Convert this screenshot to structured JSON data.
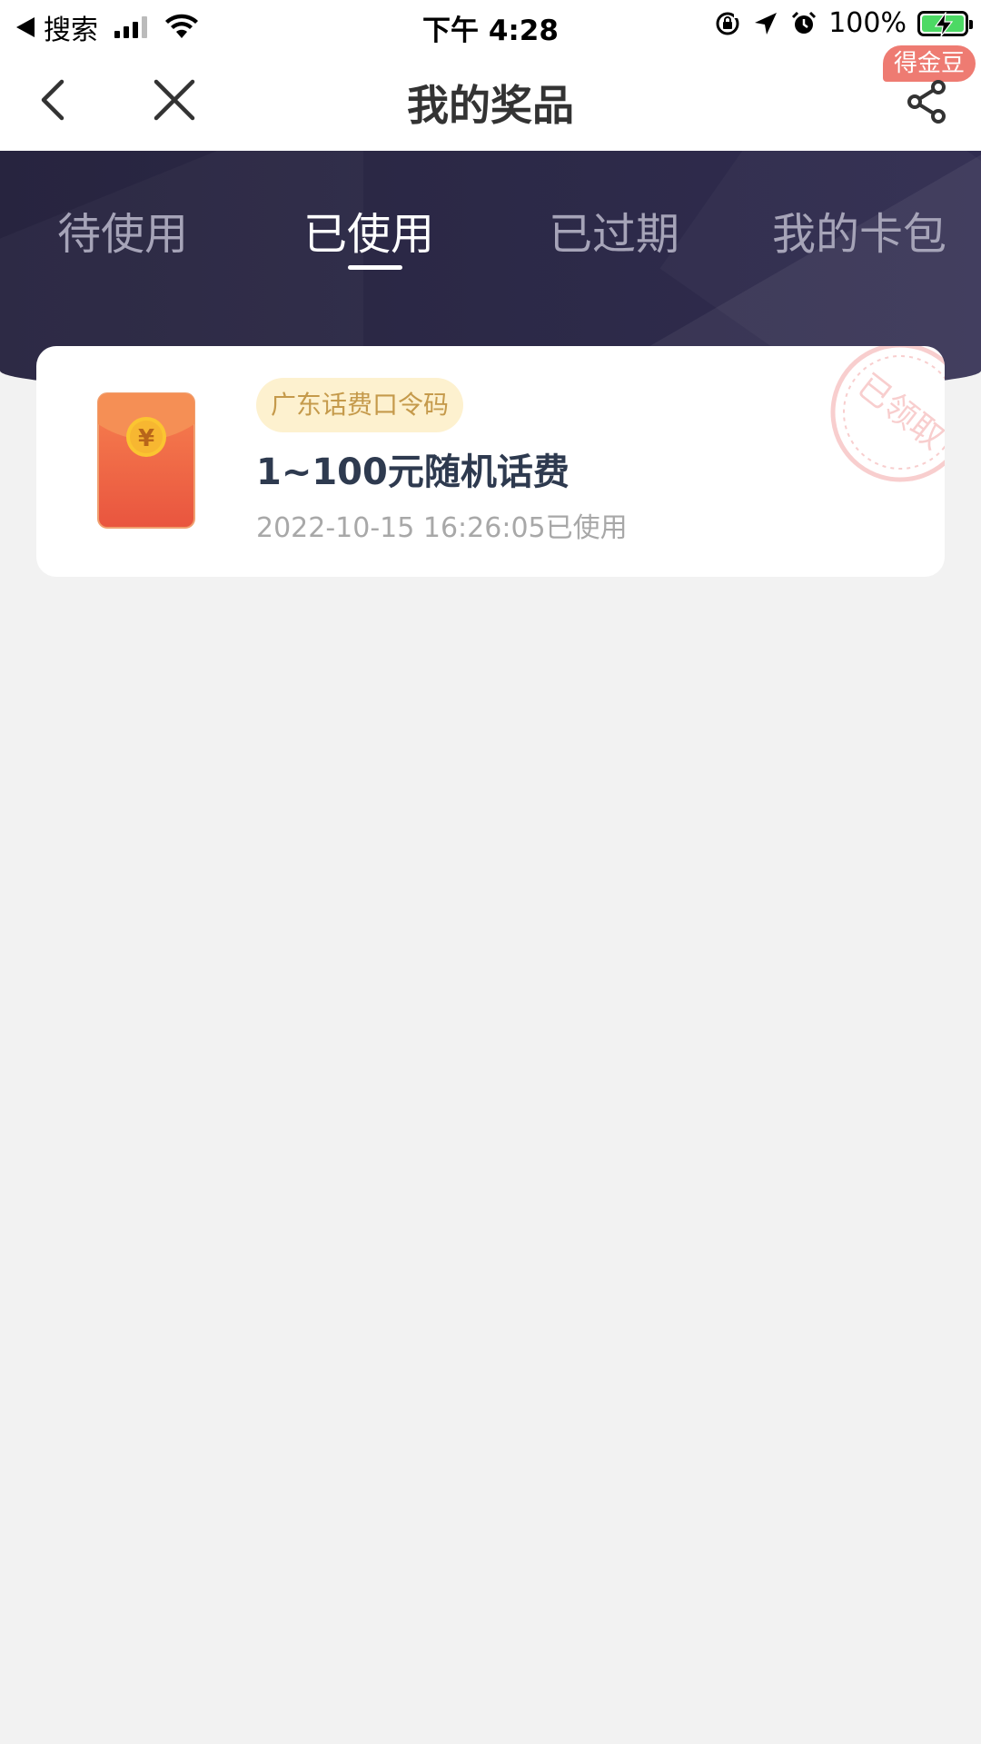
{
  "status_bar": {
    "carrier": "搜索",
    "time": "下午 4:28",
    "battery_percent": "100%"
  },
  "nav": {
    "title": "我的奖品",
    "badge": "得金豆",
    "icons": {
      "back": "back-chevron-icon",
      "close": "close-icon",
      "share": "share-icon"
    }
  },
  "tabs": [
    {
      "label": "待使用",
      "active": false
    },
    {
      "label": "已使用",
      "active": true
    },
    {
      "label": "已过期",
      "active": false
    },
    {
      "label": "我的卡包",
      "active": false
    }
  ],
  "prizes": [
    {
      "tag": "广东话费口令码",
      "name": "1~100元随机话费",
      "time_status": "2022-10-15 16:26:05已使用",
      "stamp": "已领取",
      "icon": "red-envelope-icon"
    }
  ],
  "colors": {
    "header_bg": "#2a2745",
    "tab_active": "#ffffff",
    "tab_inactive": "#a6a4b8",
    "tag_bg": "#fdf1cf",
    "tag_text": "#c59a4b",
    "badge_bg": "#ee7b72",
    "page_bg": "#f2f2f2"
  }
}
